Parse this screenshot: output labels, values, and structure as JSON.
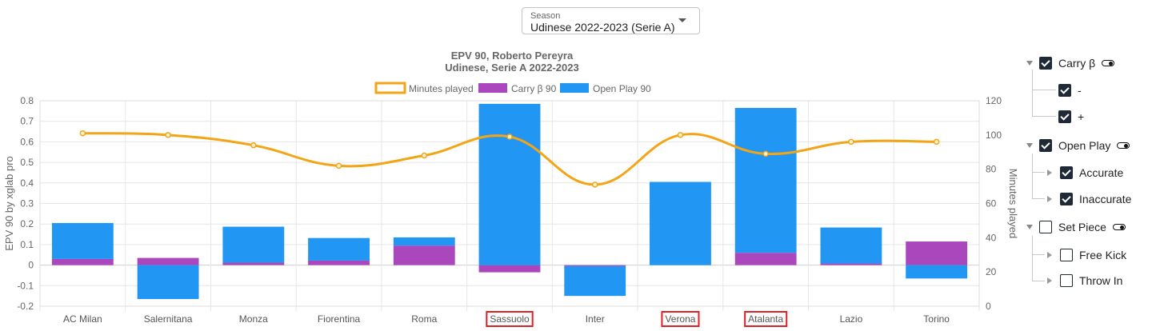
{
  "season_select": {
    "label": "Season",
    "value": "Udinese 2022-2023 (Serie A)"
  },
  "chart_data": {
    "type": "bar",
    "title": "EPV 90, Roberto Pereyra",
    "subtitle": "Udinese, Serie A 2022-2023",
    "ylabel": "EPV 90 by xglab pro",
    "y2label": "Minutes played",
    "ylim": [
      -0.2,
      0.8
    ],
    "y2lim": [
      0,
      120
    ],
    "yticks": [
      "-0.2",
      "-0.1",
      "0",
      "0.1",
      "0.2",
      "0.3",
      "0.4",
      "0.5",
      "0.6",
      "0.7",
      "0.8"
    ],
    "y2ticks": [
      "0",
      "20",
      "40",
      "60",
      "80",
      "100",
      "120"
    ],
    "categories": [
      "AC Milan",
      "Salernitana",
      "Monza",
      "Fiorentina",
      "Roma",
      "Sassuolo",
      "Inter",
      "Verona",
      "Atalanta",
      "Lazio",
      "Torino"
    ],
    "highlighted_categories": [
      "Sassuolo",
      "Verona",
      "Atalanta"
    ],
    "highlight_color": "#dd1f26",
    "grid": true,
    "legend_position": "top",
    "series": [
      {
        "name": "Minutes played",
        "type": "line",
        "axis": "right",
        "color": "#f2a516",
        "values": [
          101,
          100,
          94,
          82,
          88,
          99,
          71,
          100,
          89,
          96,
          96
        ]
      },
      {
        "name": "Carry β 90",
        "type": "bar",
        "axis": "left",
        "color": "#ab47bc",
        "values": [
          0.03,
          0.035,
          0.012,
          0.022,
          0.095,
          -0.035,
          -0.005,
          0,
          0.06,
          0.008,
          0.115
        ]
      },
      {
        "name": "Open Play 90",
        "type": "bar",
        "axis": "left",
        "color": "#2196f3",
        "values": [
          0.175,
          -0.165,
          0.175,
          0.11,
          0.04,
          0.785,
          -0.145,
          0.405,
          0.705,
          0.175,
          -0.065
        ]
      }
    ]
  },
  "tree": {
    "carry": {
      "label": "Carry β",
      "checked": true,
      "children": [
        {
          "label": "-",
          "checked": true
        },
        {
          "label": "+",
          "checked": true
        }
      ]
    },
    "open_play": {
      "label": "Open Play",
      "checked": true,
      "children": [
        {
          "label": "Accurate",
          "checked": true
        },
        {
          "label": "Inaccurate",
          "checked": true
        }
      ]
    },
    "set_piece": {
      "label": "Set Piece",
      "checked": false,
      "children": [
        {
          "label": "Free Kick",
          "checked": false
        },
        {
          "label": "Throw In",
          "checked": false
        }
      ]
    }
  }
}
